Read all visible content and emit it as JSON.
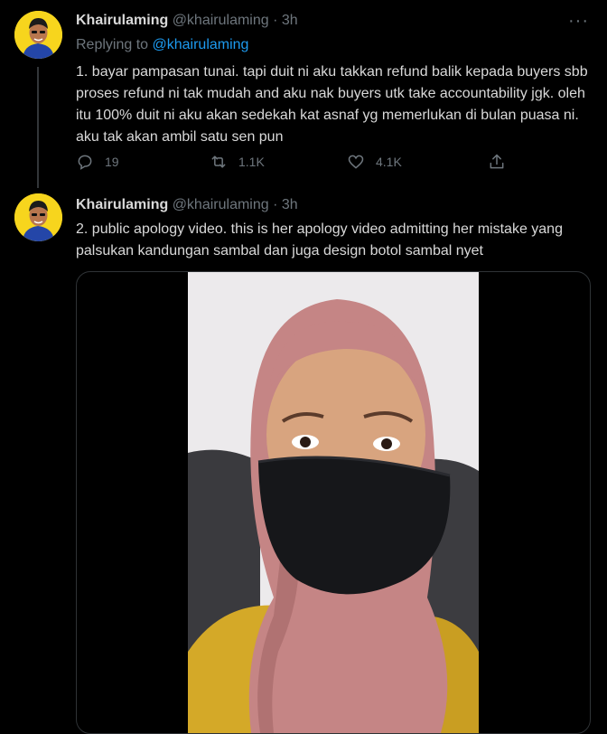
{
  "tweets": [
    {
      "author_name": "Khairulaming",
      "handle": "@khairulaming",
      "separator": "·",
      "time": "3h",
      "replying_prefix": "Replying to",
      "replying_to": "@khairulaming",
      "text": "1. bayar pampasan tunai. tapi duit ni aku takkan refund balik kepada buyers sbb proses refund ni tak mudah and aku nak buyers utk take accountability jgk. oleh itu 100% duit ni aku akan sedekah kat asnaf yg memerlukan di bulan puasa ni. aku tak akan ambil satu sen pun",
      "actions": {
        "reply_icon": "reply-icon",
        "reply_count": "19",
        "retweet_icon": "retweet-icon",
        "retweet_count": "1.1K",
        "like_icon": "heart-icon",
        "like_count": "4.1K",
        "share_icon": "share-icon"
      }
    },
    {
      "author_name": "Khairulaming",
      "handle": "@khairulaming",
      "separator": "·",
      "time": "3h",
      "text": "2. public apology video. this is her  apology video admitting her mistake yang palsukan kandungan sambal dan juga design botol sambal nyet"
    }
  ],
  "colors": {
    "background": "#000000",
    "text": "#d9d9d9",
    "muted": "#6e767d",
    "link": "#1d9bf0",
    "avatar_bg": "#f7d51d"
  }
}
